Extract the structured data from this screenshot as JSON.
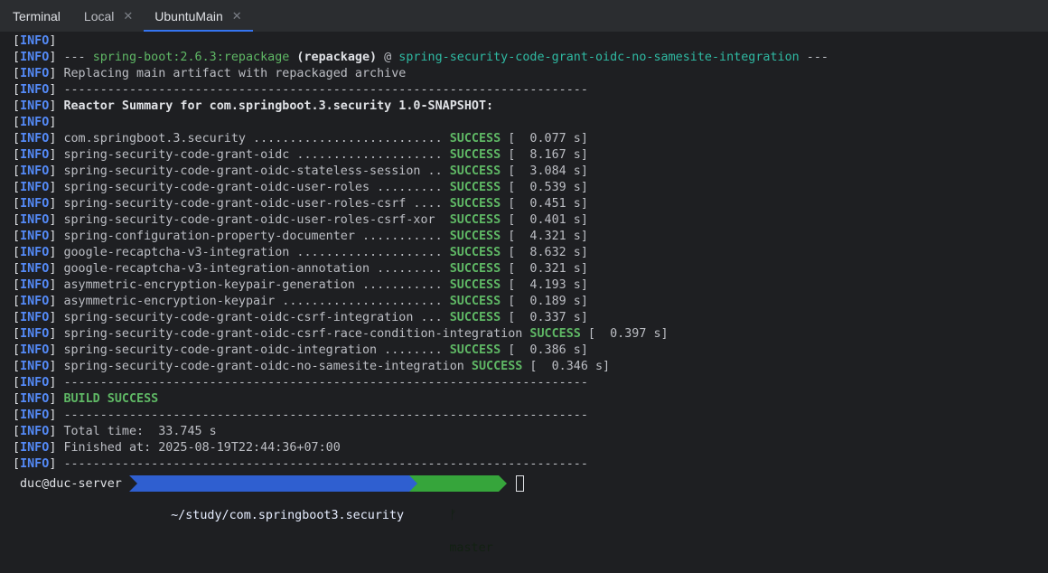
{
  "tabbar": {
    "title": "Terminal",
    "tabs": [
      {
        "label": "Local",
        "close": "✕"
      },
      {
        "label": "UbuntuMain",
        "close": "✕"
      }
    ]
  },
  "tag": "INFO",
  "lines": [
    {
      "parts": []
    },
    {
      "parts": [
        {
          "t": "--- ",
          "c": ""
        },
        {
          "t": "spring-boot:2.6.3:repackage",
          "c": "green"
        },
        {
          "t": " ",
          "c": ""
        },
        {
          "t": "(repackage)",
          "c": "bold"
        },
        {
          "t": " @ ",
          "c": ""
        },
        {
          "t": "spring-security-code-grant-oidc-no-samesite-integration",
          "c": "cyan"
        },
        {
          "t": " ---",
          "c": ""
        }
      ]
    },
    {
      "parts": [
        {
          "t": "Replacing main artifact with repackaged archive",
          "c": ""
        }
      ]
    },
    {
      "parts": [
        {
          "t": "------------------------------------------------------------------------",
          "c": ""
        }
      ]
    },
    {
      "parts": [
        {
          "t": "Reactor Summary for com.springboot.3.security 1.0-SNAPSHOT:",
          "c": "bold"
        }
      ]
    },
    {
      "parts": []
    },
    {
      "parts": [
        {
          "t": "com.springboot.3.security .......................... ",
          "c": ""
        },
        {
          "t": "SUCCESS",
          "c": "success"
        },
        {
          "t": " [  0.077 s]",
          "c": ""
        }
      ]
    },
    {
      "parts": [
        {
          "t": "spring-security-code-grant-oidc .................... ",
          "c": ""
        },
        {
          "t": "SUCCESS",
          "c": "success"
        },
        {
          "t": " [  8.167 s]",
          "c": ""
        }
      ]
    },
    {
      "parts": [
        {
          "t": "spring-security-code-grant-oidc-stateless-session .. ",
          "c": ""
        },
        {
          "t": "SUCCESS",
          "c": "success"
        },
        {
          "t": " [  3.084 s]",
          "c": ""
        }
      ]
    },
    {
      "parts": [
        {
          "t": "spring-security-code-grant-oidc-user-roles ......... ",
          "c": ""
        },
        {
          "t": "SUCCESS",
          "c": "success"
        },
        {
          "t": " [  0.539 s]",
          "c": ""
        }
      ]
    },
    {
      "parts": [
        {
          "t": "spring-security-code-grant-oidc-user-roles-csrf .... ",
          "c": ""
        },
        {
          "t": "SUCCESS",
          "c": "success"
        },
        {
          "t": " [  0.451 s]",
          "c": ""
        }
      ]
    },
    {
      "parts": [
        {
          "t": "spring-security-code-grant-oidc-user-roles-csrf-xor  ",
          "c": ""
        },
        {
          "t": "SUCCESS",
          "c": "success"
        },
        {
          "t": " [  0.401 s]",
          "c": ""
        }
      ]
    },
    {
      "parts": [
        {
          "t": "spring-configuration-property-documenter ........... ",
          "c": ""
        },
        {
          "t": "SUCCESS",
          "c": "success"
        },
        {
          "t": " [  4.321 s]",
          "c": ""
        }
      ]
    },
    {
      "parts": [
        {
          "t": "google-recaptcha-v3-integration .................... ",
          "c": ""
        },
        {
          "t": "SUCCESS",
          "c": "success"
        },
        {
          "t": " [  8.632 s]",
          "c": ""
        }
      ]
    },
    {
      "parts": [
        {
          "t": "google-recaptcha-v3-integration-annotation ......... ",
          "c": ""
        },
        {
          "t": "SUCCESS",
          "c": "success"
        },
        {
          "t": " [  0.321 s]",
          "c": ""
        }
      ]
    },
    {
      "parts": [
        {
          "t": "asymmetric-encryption-keypair-generation ........... ",
          "c": ""
        },
        {
          "t": "SUCCESS",
          "c": "success"
        },
        {
          "t": " [  4.193 s]",
          "c": ""
        }
      ]
    },
    {
      "parts": [
        {
          "t": "asymmetric-encryption-keypair ...................... ",
          "c": ""
        },
        {
          "t": "SUCCESS",
          "c": "success"
        },
        {
          "t": " [  0.189 s]",
          "c": ""
        }
      ]
    },
    {
      "parts": [
        {
          "t": "spring-security-code-grant-oidc-csrf-integration ... ",
          "c": ""
        },
        {
          "t": "SUCCESS",
          "c": "success"
        },
        {
          "t": " [  0.337 s]",
          "c": ""
        }
      ]
    },
    {
      "parts": [
        {
          "t": "spring-security-code-grant-oidc-csrf-race-condition-integration ",
          "c": ""
        },
        {
          "t": "SUCCESS",
          "c": "success"
        },
        {
          "t": " [  0.397 s]",
          "c": ""
        }
      ]
    },
    {
      "parts": [
        {
          "t": "spring-security-code-grant-oidc-integration ........ ",
          "c": ""
        },
        {
          "t": "SUCCESS",
          "c": "success"
        },
        {
          "t": " [  0.386 s]",
          "c": ""
        }
      ]
    },
    {
      "parts": [
        {
          "t": "spring-security-code-grant-oidc-no-samesite-integration ",
          "c": ""
        },
        {
          "t": "SUCCESS",
          "c": "success"
        },
        {
          "t": " [  0.346 s]",
          "c": ""
        }
      ]
    },
    {
      "parts": [
        {
          "t": "------------------------------------------------------------------------",
          "c": ""
        }
      ]
    },
    {
      "parts": [
        {
          "t": "BUILD SUCCESS",
          "c": "success"
        }
      ]
    },
    {
      "parts": [
        {
          "t": "------------------------------------------------------------------------",
          "c": ""
        }
      ]
    },
    {
      "parts": [
        {
          "t": "Total time:  33.745 s",
          "c": ""
        }
      ]
    },
    {
      "parts": [
        {
          "t": "Finished at: 2025-08-19T22:44:36+07:00",
          "c": ""
        }
      ]
    },
    {
      "parts": [
        {
          "t": "------------------------------------------------------------------------",
          "c": ""
        }
      ]
    }
  ],
  "prompt": {
    "user": "duc@duc-server",
    "path": "~/study/com.springboot3.security",
    "branch_icon": "ᚠ",
    "branch": "master"
  }
}
